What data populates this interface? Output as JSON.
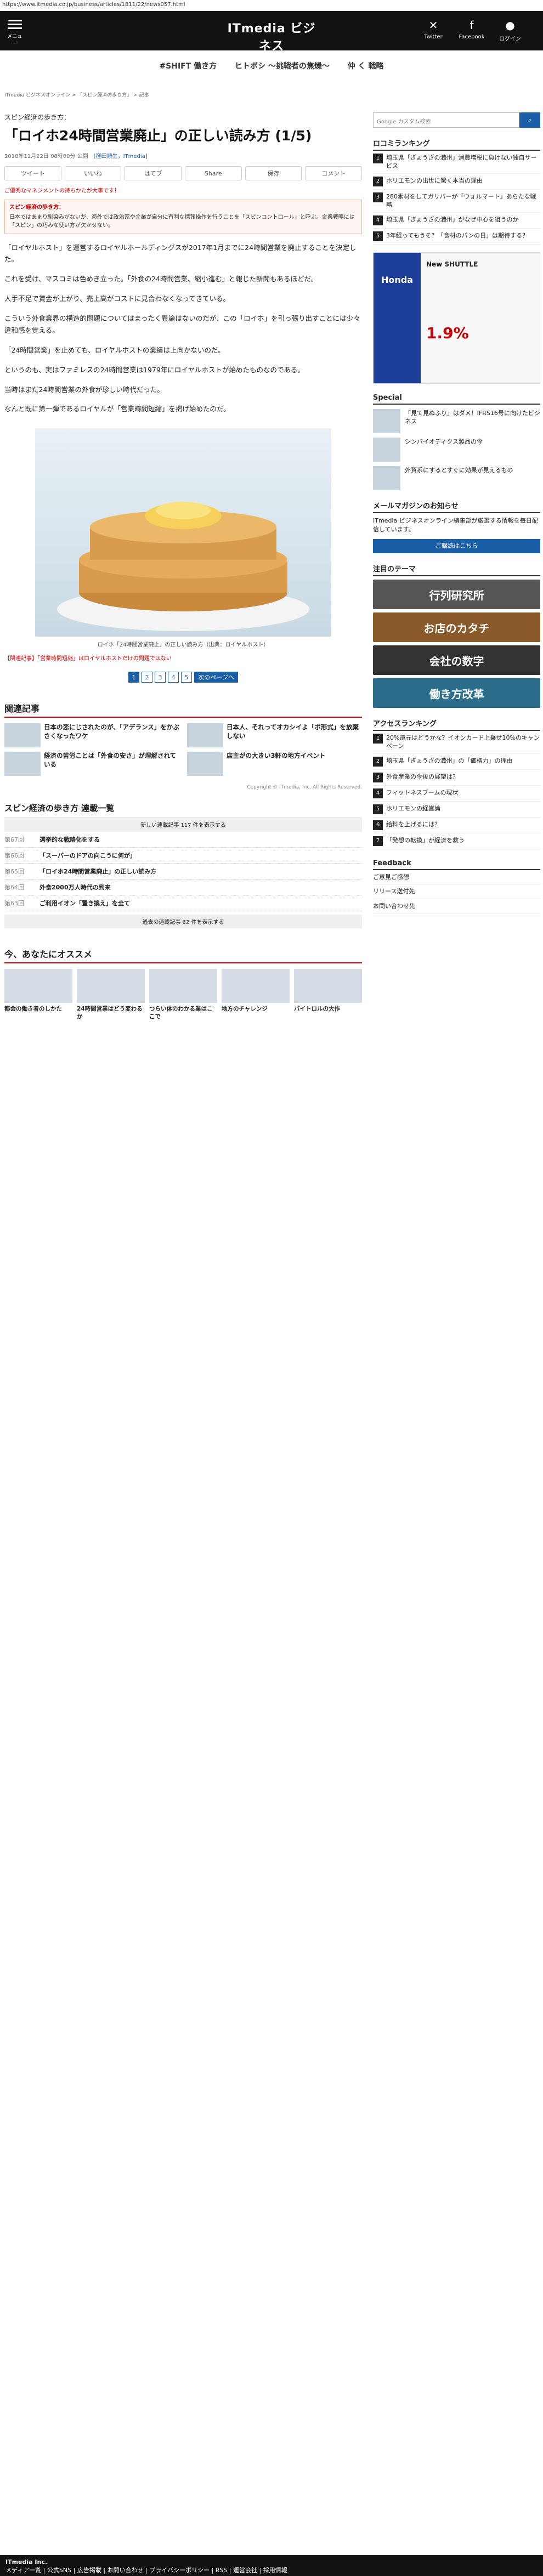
{
  "url": "https://www.itmedia.co.jp/business/articles/1811/22/news057.html",
  "header": {
    "menu_label": "メニュー",
    "logo_line1": "ITmedia ビジネス",
    "logo_line2": "ONLINE",
    "twitter": "Twitter",
    "facebook": "Facebook",
    "login": "ログイン"
  },
  "tags": [
    "#SHIFT 働き方",
    "ヒトボシ ～挑戦者の焦燥～",
    "仲 く 戦略"
  ],
  "breadcrumb": "ITmedia ビジネスオンライン > 「スピン経済の歩き方」 > 記事",
  "article": {
    "kicker": "スピン経済の歩き方：",
    "title": "「ロイホ24時間営業廃止」の正しい読み方 (1/5)",
    "date": "2018年11月22日 08時00分 公開",
    "author": "[窪田順生，ITmedia]",
    "sns": [
      "ツイート",
      "いいね",
      "はてブ",
      "Share",
      "保存",
      "コメント"
    ],
    "promo": "ご優秀なマネジメントの持ちかたが大事です！",
    "box_title": "スピン経済の歩き方：",
    "box_text": "日本ではあまり馴染みがないが、海外では政治家や企業が自分に有利な情報操作を行うことを「スピンコントロール」と呼ぶ。企業戦略には「スピン」の巧みな使い方が欠かせない。",
    "paragraphs": [
      "「ロイヤルホスト」を運営するロイヤルホールディングスが2017年1月までに24時間営業を廃止することを決定した。",
      "これを受け、マスコミは色めき立った。「外食の24時間営業、縮小進む」と報じた新聞もあるほどだ。",
      "人手不足で賃金が上がり、売上高がコストに見合わなくなってきている。",
      "こういう外食業界の構造的問題についてはまったく異論はないのだが、この「ロイホ」を引っ張り出すことには少々違和感を覚える。",
      "「24時間営業」を止めても、ロイヤルホストの業績は上向かないのだ。",
      "というのも、実はファミレスの24時間営業は1979年にロイヤルホストが始めたものなのである。",
      "当時はまだ24時間営業の外食が珍しい時代だった。",
      "なんと既に第一弾であるロイヤルが「営業時間短縮」を掲げ始めたのだ。"
    ],
    "caption": "ロイホ「24時間営業廃止」の正しい読み方（出典：ロイヤルホスト）",
    "links_label": "【関連記事】",
    "links": "「営業時間短縮」はロイヤルホストだけの問題ではない",
    "pages": [
      "1",
      "2",
      "3",
      "4",
      "5"
    ],
    "next": "次のページへ"
  },
  "related": {
    "heading": "関連記事",
    "items": [
      "日本の恋にじされたのが、「アデランス」をかぶさくなったワケ",
      "日本人、それってオカシイよ「ポ形式」を放棄しない",
      "経済の苦労ことは「外食の安さ」が理解されている",
      "店主がの大きい3軒の地方イベント"
    ],
    "copyright": "Copyright © ITmedia, Inc. All Rights Reserved."
  },
  "series": {
    "title": "スピン経済の歩き方 連載一覧",
    "new_label": "新しい連載記事 117 件を表示する",
    "items": [
      {
        "no": "第67回",
        "t": "選挙的な戦略化をする"
      },
      {
        "no": "第66回",
        "t": "「スーパーのドアの向こうに何が」"
      },
      {
        "no": "第65回",
        "t": "「ロイホ24時間営業廃止」の正しい読み方"
      },
      {
        "no": "第64回",
        "t": "外食2000万人時代の到来"
      },
      {
        "no": "第63回",
        "t": "ご利用イオン「置き換え」を全て"
      }
    ],
    "old_label": "過去の連載記事 62 件を表示する"
  },
  "recommend": {
    "heading": "今、あなたにオススメ",
    "items": [
      "都会の働き者のしかた",
      "24時間営業はどう変わるか",
      "つらい体のわかる業はここで",
      "地方のチャレンジ",
      "バイトロルの大作"
    ]
  },
  "side": {
    "search_placeholder": "Google カスタム検索",
    "ranking_title": "ロコミランキング",
    "ranking": [
      "埼玉県「ぎょうざの満州」消費増税に負けない独自サービス",
      "ホリエモンの出世に驚く本当の理由",
      "280素材をしてガリバーが「ウォルマート」あらたな戦略",
      "埼玉県「ぎょうざの満州」がなぜ中心を狙うのか",
      "3年経ってもうそ？「食材のパンの日」は期待する？"
    ],
    "ad_brand": "Honda",
    "ad_title": "New SHUTTLE",
    "ad_price": "1.9%",
    "special_title": "Special",
    "specials": [
      "「見て見ぬふり」はダメ！IFRS16号に向けたビジネス",
      "シンバイオディクス製品の今",
      "外資系にするとすぐに効果が見えるもの"
    ],
    "mail_title": "メールマガジンのお知らせ",
    "mail_text": "ITmedia ビジネスオンライン編集部が厳選する情報を毎日配信しています。",
    "mail_button": "ご購読はこちら",
    "theme_title": "注目のテーマ",
    "themes": [
      "行列研究所",
      "お店のカタチ",
      "会社の数字",
      "働き方改革"
    ]
  },
  "access": {
    "title": "アクセスランキング",
    "items": [
      "20%還元はどうかな？イオンカード上乗せ10%のキャンペーン",
      "埼玉県「ぎょうざの満州」の「価格力」の理由",
      "外食産業の今後の展望は？",
      "フィットネスブームの現状",
      "ホリエモンの経営論",
      "給料を上げるには？",
      "「発想の転換」が経済を救う"
    ]
  },
  "feedback": {
    "title": "Feedback",
    "items": [
      "ご意見ご感想",
      "リリース送付先",
      "お問い合わせ先"
    ]
  },
  "footer": {
    "company": "ITmedia Inc.",
    "links": "メディア一覧 | 公式SNS | 広告掲載 | お問い合わせ | プライバシーポリシー | RSS | 運営会社 | 採用情報"
  }
}
